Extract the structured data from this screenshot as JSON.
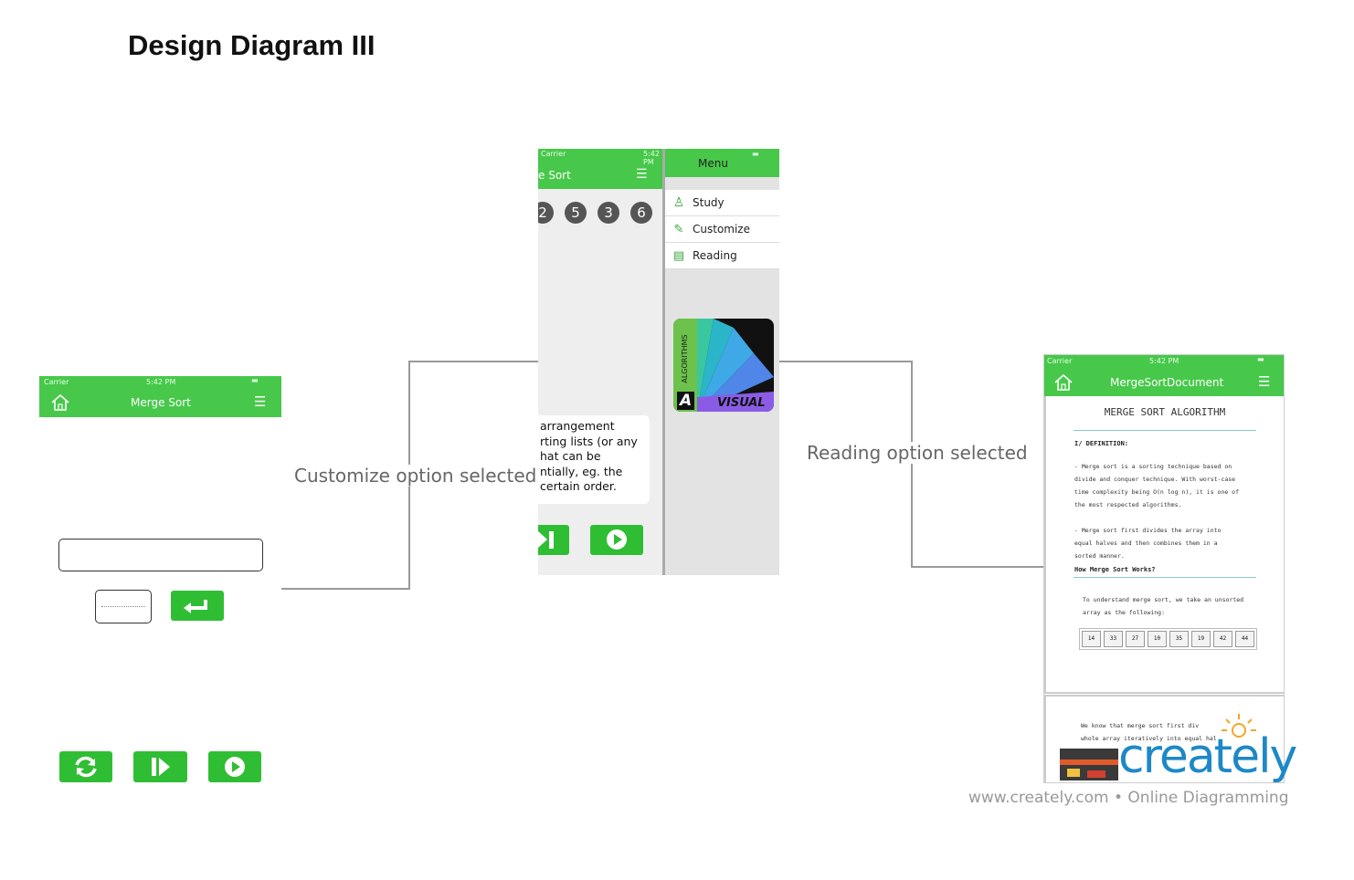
{
  "title": "Design Diagram III",
  "labels": {
    "customize": "Customize option selected",
    "reading": "Reading option selected"
  },
  "left_screen": {
    "carrier": "Carrier",
    "time": "5:42 PM",
    "nav_title": "Merge Sort",
    "home_icon": "home-icon",
    "menu_icon": "hamburger-icon",
    "enter_icon": "enter-arrow-icon",
    "controls": [
      "refresh-icon",
      "step-forward-icon",
      "play-icon"
    ]
  },
  "middle_screen": {
    "carrier": "Carrier",
    "time": "5:42 PM",
    "nav_title": "e Sort",
    "circles": [
      "2",
      "5",
      "3",
      "6"
    ],
    "text_lines": [
      "arrangement",
      "rting lists (or any",
      "hat can be",
      "ntially, eg. the",
      "certain order."
    ],
    "menu": {
      "title": "Menu",
      "items": [
        {
          "label": "Study",
          "icon": "person-icon"
        },
        {
          "label": "Customize",
          "icon": "edit-icon"
        },
        {
          "label": "Reading",
          "icon": "books-icon"
        }
      ]
    },
    "logo": {
      "side_text": "ALGORITHMS",
      "letter": "A",
      "word": "VISUAL"
    }
  },
  "right_screen": {
    "carrier": "Carrier",
    "time": "5:42 PM",
    "nav_title": "MergeSortDocument",
    "doc_title": "MERGE SORT ALGORITHM",
    "section": "I/ DEFINITION:",
    "para1": [
      "- Merge sort is a sorting technique based on",
      "divide and conquer technique. With worst-case",
      "time complexity being O(n log n), it is one of",
      "the most respected algorithms."
    ],
    "para2": [
      "- Merge sort first divides the array into",
      "equal halves and then combines them in a",
      "sorted manner."
    ],
    "subheading": "How Merge Sort Works?",
    "para3": [
      "To understand merge sort, we take an unsorted",
      "array as the following:"
    ],
    "array": [
      "14",
      "33",
      "27",
      "10",
      "35",
      "19",
      "42",
      "44"
    ],
    "bottom_lines": [
      "We know that merge sort first div",
      "whole array iteratively into equal hal"
    ]
  },
  "watermark": {
    "brand": "creately",
    "tagline": "www.creately.com • Online Diagramming"
  },
  "colors": {
    "green": "#47c84a",
    "button_green": "#2fbe33",
    "line_gray": "#999999",
    "brand_blue": "#1e88c7",
    "brand_orange": "#f5a623"
  }
}
